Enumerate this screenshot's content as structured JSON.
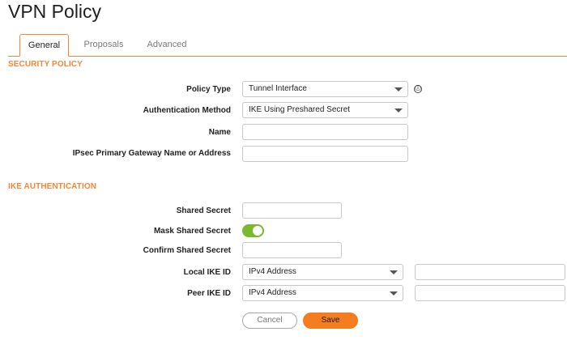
{
  "page": {
    "title": "VPN Policy"
  },
  "tabs": [
    {
      "label": "General",
      "active": true
    },
    {
      "label": "Proposals",
      "active": false
    },
    {
      "label": "Advanced",
      "active": false
    }
  ],
  "security_policy": {
    "title": "SECURITY POLICY",
    "policy_type": {
      "label": "Policy Type",
      "value": "Tunnel Interface",
      "info_icon": "ⓘ"
    },
    "auth_method": {
      "label": "Authentication Method",
      "value": "IKE Using Preshared Secret"
    },
    "name": {
      "label": "Name",
      "value": ""
    },
    "gateway": {
      "label": "IPsec Primary Gateway Name or Address",
      "value": ""
    }
  },
  "ike_auth": {
    "title": "IKE AUTHENTICATION",
    "shared_secret": {
      "label": "Shared Secret",
      "value": ""
    },
    "mask_shared_secret": {
      "label": "Mask Shared Secret",
      "on": true
    },
    "confirm_secret": {
      "label": "Confirm Shared Secret",
      "value": ""
    },
    "local_ike": {
      "label": "Local IKE ID",
      "type": "IPv4 Address",
      "value": ""
    },
    "peer_ike": {
      "label": "Peer IKE ID",
      "type": "IPv4 Address",
      "value": ""
    }
  },
  "actions": {
    "cancel": "Cancel",
    "save": "Save"
  },
  "colors": {
    "accent": "#f0883a",
    "toggle_on": "#7cb82f",
    "save": "#f57c1f"
  }
}
